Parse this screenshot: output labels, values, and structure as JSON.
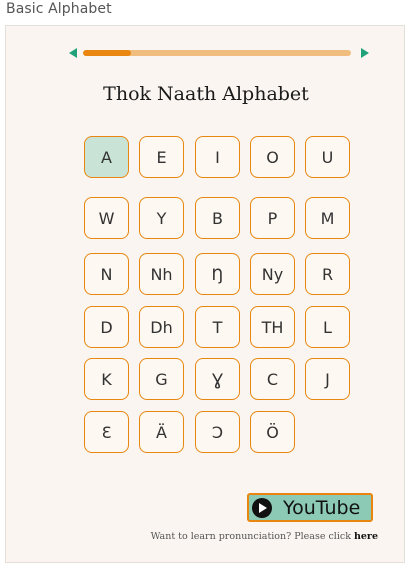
{
  "header": {
    "title": "Basic Alphabet"
  },
  "progress": {
    "fraction": 0.18
  },
  "main": {
    "title": "Thok Naath Alphabet"
  },
  "letters": [
    "A",
    "E",
    "I",
    "O",
    "U",
    "W",
    "Y",
    "B",
    "P",
    "M",
    "N",
    "Nh",
    "Ŋ",
    "Ny",
    "R",
    "D",
    "Dh",
    "T",
    "TH",
    "L",
    "K",
    "G",
    "Ɣ",
    "C",
    "J",
    "Ɛ",
    "Ä",
    "Ɔ",
    "Ö"
  ],
  "selected_letter": "A",
  "video": {
    "button_label": "YouTube",
    "icon": "play-circle-icon"
  },
  "footer": {
    "text": "Want to learn pronunciation? Please click ",
    "link": "here"
  },
  "colors": {
    "accent": "#e8860f",
    "arrow": "#1fa27a",
    "selected": "#c9e3d7",
    "button": "#8ccab6"
  }
}
